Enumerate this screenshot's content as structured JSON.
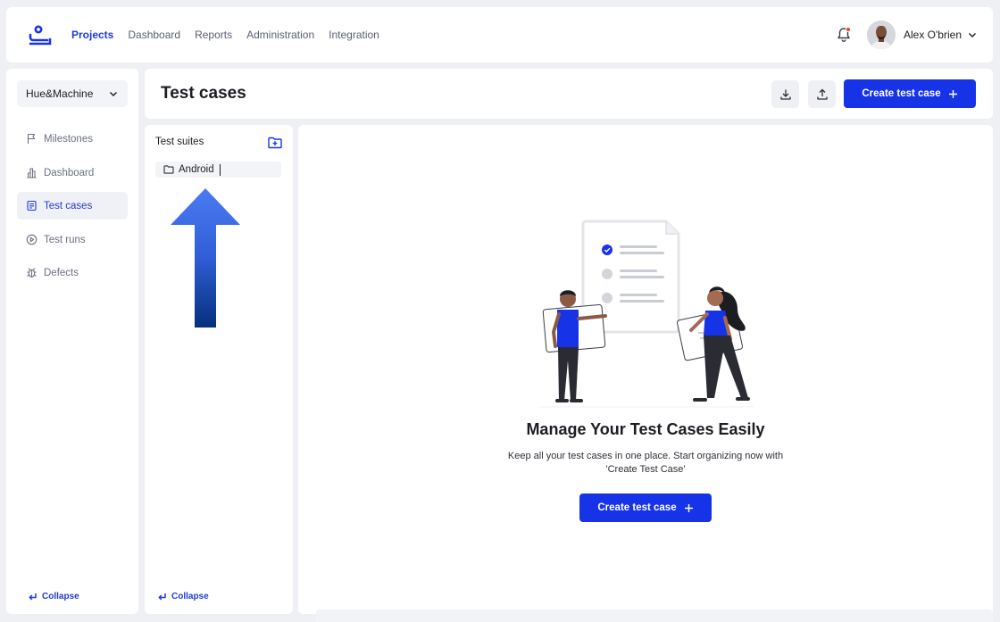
{
  "topbar": {
    "nav": [
      {
        "label": "Projects",
        "active": true
      },
      {
        "label": "Dashboard",
        "active": false
      },
      {
        "label": "Reports",
        "active": false
      },
      {
        "label": "Administration",
        "active": false
      },
      {
        "label": "Integration",
        "active": false
      }
    ],
    "user_name": "Alex O'brien",
    "notification_dot": true,
    "icons": {
      "logo": "app-logo",
      "bell": "bell-icon",
      "chevron": "chevron-down-icon"
    }
  },
  "sidebar": {
    "project": "Hue&Machine",
    "items": [
      {
        "label": "Milestones",
        "icon": "flag-icon",
        "active": false
      },
      {
        "label": "Dashboard",
        "icon": "bar-chart-icon",
        "active": false
      },
      {
        "label": "Test cases",
        "icon": "document-list-icon",
        "active": true
      },
      {
        "label": "Test runs",
        "icon": "play-circle-icon",
        "active": false
      },
      {
        "label": "Defects",
        "icon": "bug-icon",
        "active": false
      }
    ],
    "collapse_label": "Collapse"
  },
  "header": {
    "title": "Test cases",
    "download_icon": "download-icon",
    "upload_icon": "upload-icon",
    "create_label": "Create test case"
  },
  "suites": {
    "title": "Test suites",
    "add_icon": "add-folder-icon",
    "items": [
      {
        "label": "Android",
        "icon": "folder-icon",
        "editing": true
      }
    ],
    "collapse_label": "Collapse"
  },
  "empty_state": {
    "title": "Manage Your Test Cases Easily",
    "description_line1": "Keep all your test cases in one place. Start organizing now with",
    "description_line2": "'Create Test Case'",
    "cta_label": "Create test case"
  },
  "colors": {
    "accent": "#1733e8",
    "nav_active": "#1f3bd8",
    "background": "#eef0f4",
    "notification": "#f23b3b"
  }
}
